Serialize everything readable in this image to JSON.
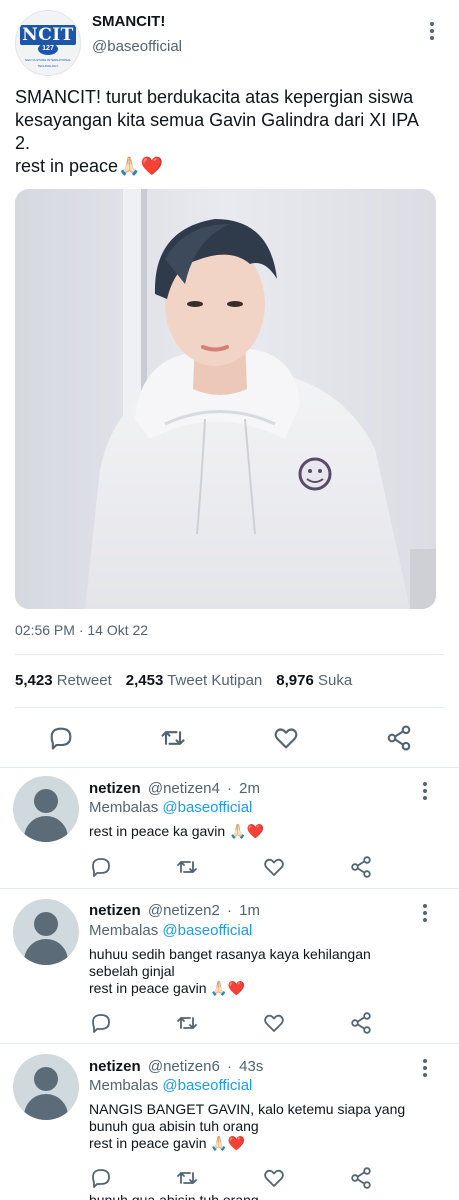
{
  "account": {
    "name": "SMANCIT!",
    "handle": "@baseofficial",
    "logo_text": "NCIT",
    "logo_number": "127",
    "logo_subtext": "NEO CULTURE INTERNATIONAL TECHNOLOGY"
  },
  "tweet": {
    "lines": [
      "SMANCIT! turut berdukacita atas kepergian siswa",
      "kesayangan kita semua Gavin Galindra dari XI IPA",
      "2.",
      "rest in peace🙏🏻❤️"
    ],
    "timestamp": "02:56 PM · 14 Okt 22"
  },
  "stats": {
    "retweets": "5,423",
    "retweets_label": "Retweet",
    "quotes": "2,453",
    "quotes_label": "Tweet Kutipan",
    "likes": "8,976",
    "likes_label": "Suka"
  },
  "replies": [
    {
      "name": "netizen",
      "handle": "@netizen4",
      "time": "2m",
      "replying_prefix": "Membalas",
      "replying_to": "@baseofficial",
      "lines": [
        "rest in peace ka gavin 🙏🏻❤️"
      ]
    },
    {
      "name": "netizen",
      "handle": "@netizen2",
      "time": "1m",
      "replying_prefix": "Membalas",
      "replying_to": "@baseofficial",
      "lines": [
        "huhuu sedih banget rasanya kaya kehilangan",
        "sebelah ginjal",
        "rest in peace gavin 🙏🏻❤️"
      ]
    },
    {
      "name": "netizen",
      "handle": "@netizen6",
      "time": "43s",
      "replying_prefix": "Membalas",
      "replying_to": "@baseofficial",
      "lines": [
        "NANGIS BANGET GAVIN, kalo ketemu siapa yang",
        "bunuh gua abisin tuh orang",
        "rest in peace gavin 🙏🏻❤️"
      ]
    }
  ],
  "partial_text": "bunuh gua abisin tuh orang",
  "icons": {
    "reply": "reply-icon",
    "retweet": "retweet-icon",
    "like": "heart-icon",
    "share": "share-icon",
    "more": "more-icon"
  },
  "colors": {
    "accent": "#1d9bf0",
    "secondary_text": "#536471",
    "logo_blue": "#1c56a8"
  }
}
